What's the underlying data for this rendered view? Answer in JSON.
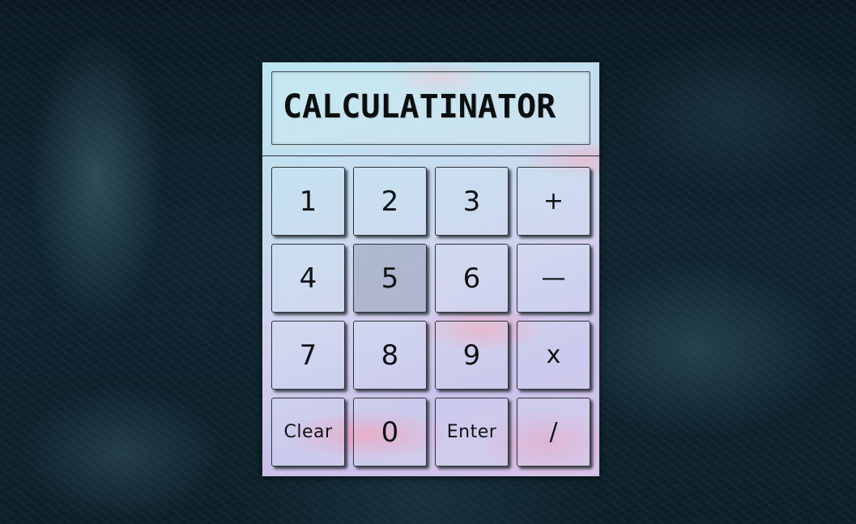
{
  "display": {
    "text": "CALCULATINATOR"
  },
  "keys": [
    {
      "label": "1",
      "name": "key-1"
    },
    {
      "label": "2",
      "name": "key-2"
    },
    {
      "label": "3",
      "name": "key-3"
    },
    {
      "label": "+",
      "name": "key-plus"
    },
    {
      "label": "4",
      "name": "key-4"
    },
    {
      "label": "5",
      "name": "key-5"
    },
    {
      "label": "6",
      "name": "key-6"
    },
    {
      "label": "—",
      "name": "key-minus"
    },
    {
      "label": "7",
      "name": "key-7"
    },
    {
      "label": "8",
      "name": "key-8"
    },
    {
      "label": "9",
      "name": "key-9"
    },
    {
      "label": "x",
      "name": "key-multiply"
    },
    {
      "label": "Clear",
      "name": "clear-button"
    },
    {
      "label": "0",
      "name": "key-0"
    },
    {
      "label": "Enter",
      "name": "enter-button"
    },
    {
      "label": "/",
      "name": "key-divide"
    }
  ],
  "colors": {
    "background": "#0f2430",
    "key_text": "#0e1213",
    "display_text": "#0c0f10"
  }
}
